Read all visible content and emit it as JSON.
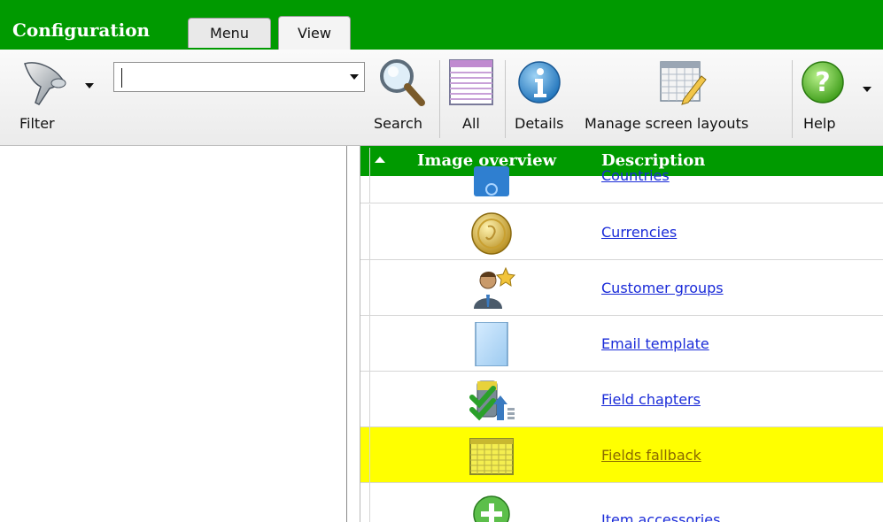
{
  "titlebar": {
    "app_title": "Configuration",
    "tabs": [
      {
        "label": "Menu"
      },
      {
        "label": "View"
      }
    ]
  },
  "toolbar": {
    "filter": {
      "label": "Filter",
      "icon": "funnel-icon"
    },
    "search_input": {
      "value": "",
      "placeholder": ""
    },
    "search": {
      "label": "Search",
      "icon": "magnifier-icon"
    },
    "all": {
      "label": "All",
      "icon": "table-icon"
    },
    "details": {
      "label": "Details",
      "icon": "info-icon"
    },
    "manage_layouts": {
      "label": "Manage screen layouts",
      "icon": "grid-pencil-icon"
    },
    "help": {
      "label": "Help",
      "icon": "question-icon"
    }
  },
  "grid": {
    "columns": [
      "Image overview",
      "Description"
    ],
    "sort_direction": "ascending",
    "rows": [
      {
        "description": "Countries",
        "icon": "globe-icon",
        "selected": false
      },
      {
        "description": "Currencies",
        "icon": "coin-icon",
        "selected": false
      },
      {
        "description": "Customer groups",
        "icon": "person-star-icon",
        "selected": false
      },
      {
        "description": "Email template",
        "icon": "blank-page-icon",
        "selected": false
      },
      {
        "description": "Field chapters",
        "icon": "checklist-icon",
        "selected": false
      },
      {
        "description": "Fields fallback",
        "icon": "grid-icon",
        "selected": true
      },
      {
        "description": "Item accessories",
        "icon": "plus-circle-icon",
        "selected": false
      }
    ]
  },
  "colors": {
    "brand_green": "#009a00",
    "selection_yellow": "#ffff00",
    "link_blue": "#1a2bd8"
  }
}
